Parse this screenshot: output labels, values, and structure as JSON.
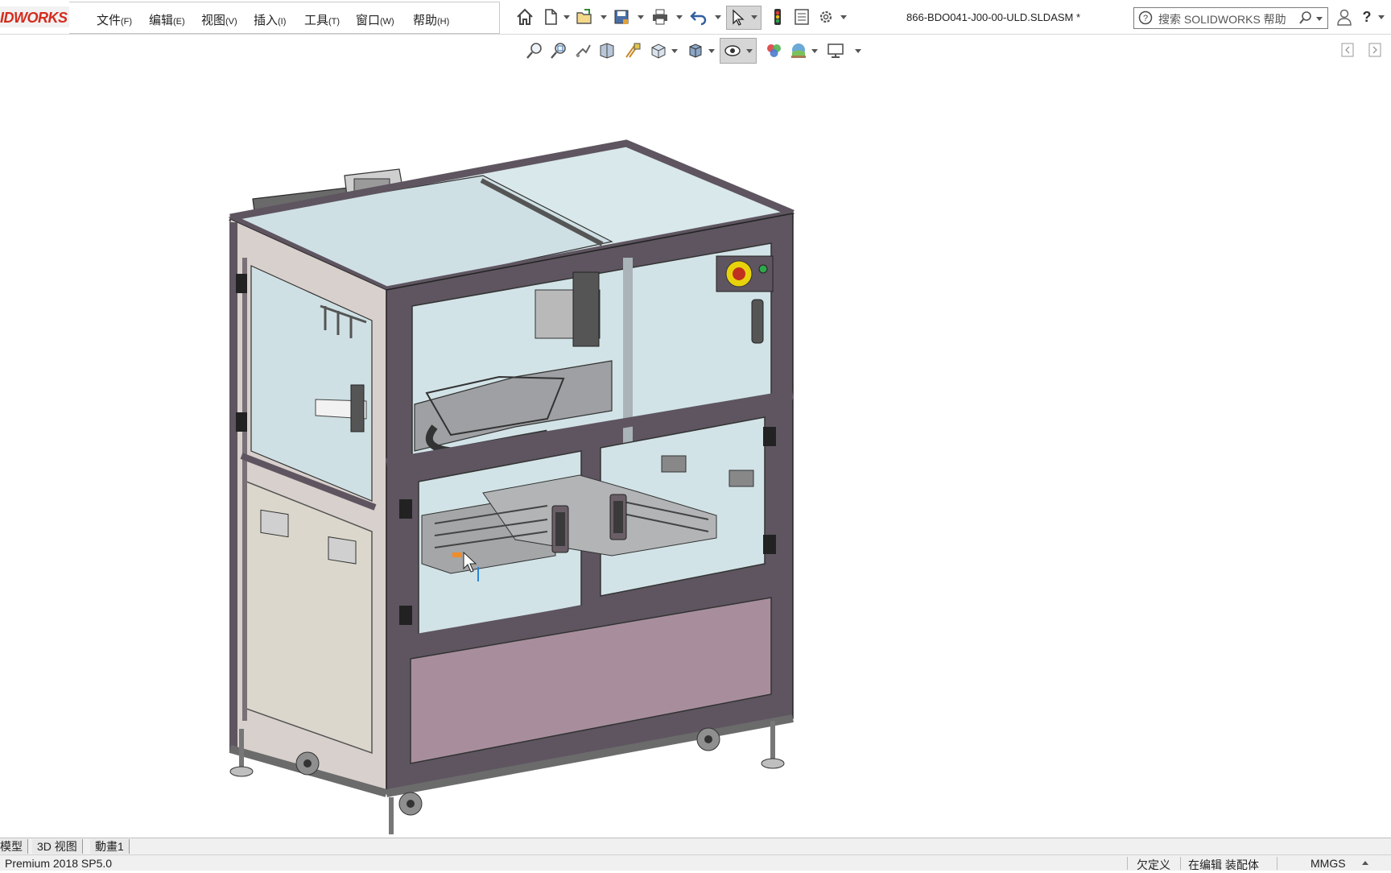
{
  "app": {
    "logo_text": "IDWORKS",
    "document_title": "866-BDO041-J00-00-ULD.SLDASM *"
  },
  "menu": {
    "items": [
      {
        "label": "文件",
        "key": "(F)"
      },
      {
        "label": "编辑",
        "key": "(E)"
      },
      {
        "label": "视图",
        "key": "(V)"
      },
      {
        "label": "插入",
        "key": "(I)"
      },
      {
        "label": "工具",
        "key": "(T)"
      },
      {
        "label": "窗口",
        "key": "(W)"
      },
      {
        "label": "帮助",
        "key": "(H)"
      }
    ]
  },
  "toolbar": {
    "icons": [
      "home-icon",
      "new-file-icon",
      "open-file-icon",
      "save-icon",
      "print-icon",
      "undo-icon",
      "select-icon",
      "rebuild-icon",
      "file-properties-icon",
      "options-icon"
    ]
  },
  "search": {
    "placeholder": "搜索 SOLIDWORKS 帮助"
  },
  "view_toolbar": {
    "icons": [
      "zoom-to-fit-icon",
      "zoom-to-area-icon",
      "previous-view-icon",
      "section-view-icon",
      "dynamic-annotation-icon",
      "view-orientation-icon",
      "display-style-icon",
      "hide-show-items-icon",
      "edit-appearance-icon",
      "apply-scene-icon",
      "view-settings-icon"
    ]
  },
  "bottom_tabs": {
    "items": [
      "模型",
      "3D 视图",
      "動畫1"
    ]
  },
  "status": {
    "version": "Premium 2018 SP5.0",
    "definition": "欠定义",
    "mode": "在编辑 装配体",
    "units": "MMGS"
  },
  "colors": {
    "logo_red": "#d52b1e",
    "frame_dark": "#5e5560",
    "panel_mauve": "#a88e9d",
    "glass": "#cfe0e4",
    "estop_yellow": "#e8d20c"
  }
}
